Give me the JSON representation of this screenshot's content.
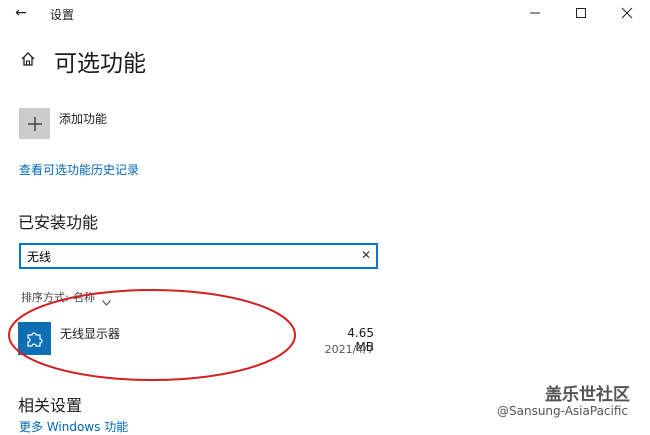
{
  "titlebar": {
    "title": "设置"
  },
  "header": {
    "title": "可选功能"
  },
  "add_feature": {
    "label": "添加功能"
  },
  "links": {
    "history": "查看可选功能历史记录",
    "more_windows_features": "更多 Windows 功能"
  },
  "installed": {
    "title": "已安装功能",
    "search": {
      "value": "无线",
      "placeholder": ""
    },
    "sort": {
      "label": "排序方式:",
      "value": "名称"
    },
    "items": [
      {
        "name": "无线显示器",
        "size": "4.65 MB",
        "date": "2021/4/7",
        "icon": "puzzle-icon"
      }
    ]
  },
  "related": {
    "title": "相关设置"
  },
  "watermark": {
    "brand": "盖乐世社区",
    "handle": "@Sansung-AsiaPacific"
  },
  "colors": {
    "accent": "#0078d7",
    "link": "#0067b8",
    "feature_tile": "#0f6fb4",
    "annotation": "#d42020"
  }
}
